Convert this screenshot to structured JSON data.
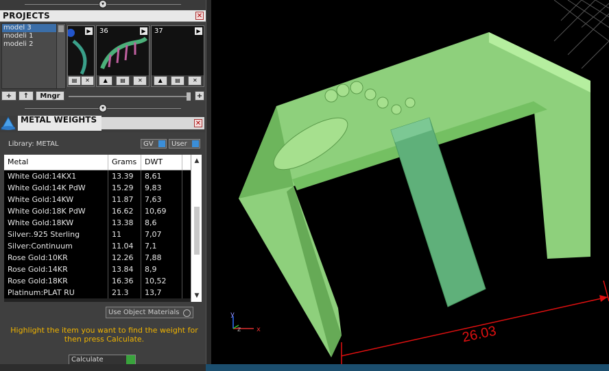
{
  "projects_panel": {
    "title": "PROJECTS",
    "models": [
      "model 3",
      "modeli 1",
      "modeli 2"
    ],
    "selected_model": "model 3",
    "thumbnails": [
      {
        "number": ""
      },
      {
        "number": "36"
      },
      {
        "number": "37"
      }
    ],
    "toolbar": {
      "add_label": "+",
      "up_label": "↑",
      "manager_label": "Mngr",
      "plus_label": "+"
    }
  },
  "metal_weights_panel": {
    "title": "METAL WEIGHTS",
    "library_label": "Library: METAL",
    "gv_label": "GV",
    "user_label": "User",
    "columns": [
      "Metal",
      "Grams",
      "DWT"
    ],
    "rows": [
      {
        "metal": "White Gold:14KX1",
        "grams": "13.39",
        "dwt": "8,61"
      },
      {
        "metal": "White Gold:14K PdW",
        "grams": "15.29",
        "dwt": "9,83"
      },
      {
        "metal": "White Gold:14KW",
        "grams": "11.87",
        "dwt": "7,63"
      },
      {
        "metal": "White Gold:18K PdW",
        "grams": "16.62",
        "dwt": "10,69"
      },
      {
        "metal": "White Gold:18KW",
        "grams": "13.38",
        "dwt": "8,6"
      },
      {
        "metal": "Silver:.925 Sterling",
        "grams": "11",
        "dwt": "7,07"
      },
      {
        "metal": "Silver:Continuum",
        "grams": "11.04",
        "dwt": "7,1"
      },
      {
        "metal": "Rose Gold:10KR",
        "grams": "12.26",
        "dwt": "7,88"
      },
      {
        "metal": "Rose Gold:14KR",
        "grams": "13.84",
        "dwt": "8,9"
      },
      {
        "metal": "Rose Gold:18KR",
        "grams": "16.36",
        "dwt": "10,52"
      },
      {
        "metal": "Platinum:PLAT RU",
        "grams": "21.3",
        "dwt": "13,7"
      }
    ],
    "use_object_materials_label": "Use Object Materials",
    "hint": "Highlight the item you want to find the weight for then press Calculate.",
    "calculate_label": "Calculate"
  },
  "viewport": {
    "dimension_value": "26.03",
    "axes": {
      "x": "x",
      "y": "y",
      "z": "z"
    }
  },
  "colors": {
    "model_green": "#8ed07c",
    "dimension_red": "#e01010",
    "hint_yellow": "#f0b400",
    "selection_blue": "#3b6ea8"
  }
}
